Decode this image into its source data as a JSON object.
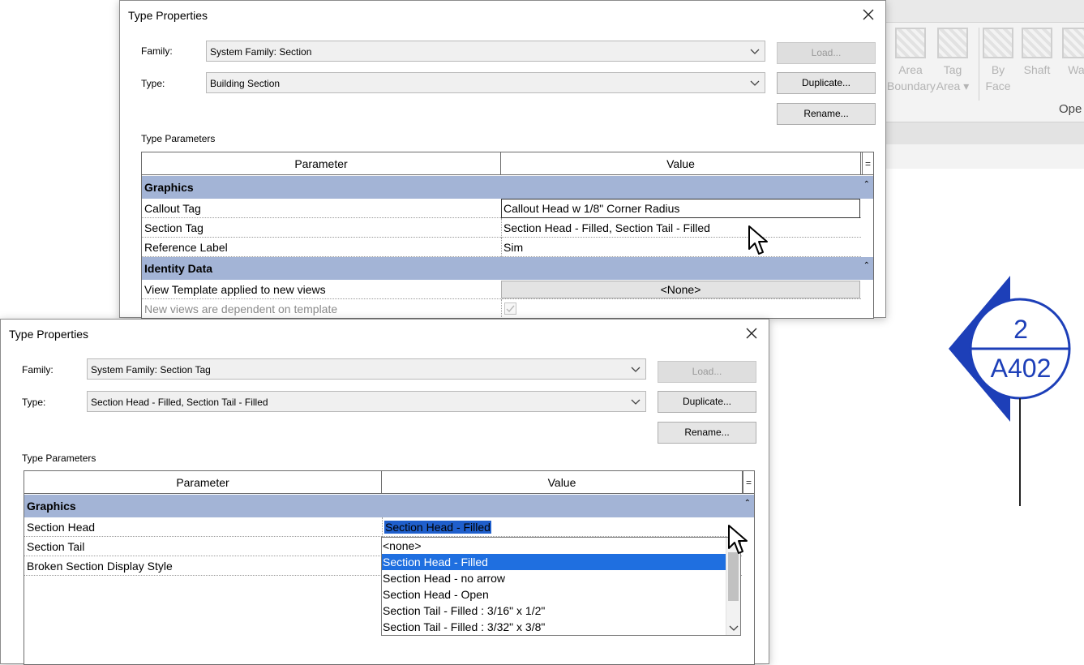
{
  "ribbon": {
    "buttons": [
      {
        "label": "Area\nBoundary"
      },
      {
        "label": "Tag\nArea ▾"
      },
      {
        "label": "By\nFace"
      },
      {
        "label": "Shaft"
      },
      {
        "label": "Wal"
      }
    ],
    "group_label": "Ope"
  },
  "section_mark": {
    "number": "2",
    "sheet": "A402",
    "color": "#1d3fb8"
  },
  "dialog_back": {
    "title": "Type Properties",
    "family_label": "Family:",
    "family_value": "System Family: Section",
    "type_label": "Type:",
    "type_value": "Building Section",
    "load_label": "Load...",
    "duplicate_label": "Duplicate...",
    "rename_label": "Rename...",
    "type_parameters_label": "Type Parameters",
    "col_parameter": "Parameter",
    "col_value": "Value",
    "col_eq": "=",
    "groups": [
      {
        "name": "Graphics",
        "caret": "⌃"
      },
      {
        "name": "Identity Data",
        "caret": "⌃"
      }
    ],
    "rows": [
      {
        "param": "Callout Tag",
        "value": "Callout Head w 1/8\" Corner Radius"
      },
      {
        "param": "Section Tag",
        "value": "Section Head - Filled, Section Tail - Filled"
      },
      {
        "param": "Reference Label",
        "value": "Sim"
      },
      {
        "param": "View Template applied to new views",
        "value": "<None>"
      },
      {
        "param": "New views are dependent on template",
        "value": ""
      }
    ]
  },
  "dialog_front": {
    "title": "Type Properties",
    "family_label": "Family:",
    "family_value": "System Family: Section Tag",
    "type_label": "Type:",
    "type_value": "Section Head - Filled, Section Tail - Filled",
    "load_label": "Load...",
    "duplicate_label": "Duplicate...",
    "rename_label": "Rename...",
    "type_parameters_label": "Type Parameters",
    "col_parameter": "Parameter",
    "col_value": "Value",
    "col_eq": "=",
    "groups": [
      {
        "name": "Graphics",
        "caret": "⌃"
      }
    ],
    "rows": [
      {
        "param": "Section Head",
        "value": "Section Head - Filled"
      },
      {
        "param": "Section Tail",
        "value": ""
      },
      {
        "param": "Broken Section Display Style",
        "value": ""
      }
    ],
    "dropdown_options": [
      "<none>",
      "Section Head - Filled",
      "Section Head - no arrow",
      "Section Head - Open",
      "Section Tail - Filled : 3/16\" x 1/2\"",
      "Section Tail - Filled : 3/32\" x 3/8\""
    ],
    "dropdown_selected_index": 1
  },
  "colors": {
    "group_header": "#a3b4d6",
    "selection": "#1f6fe0"
  }
}
